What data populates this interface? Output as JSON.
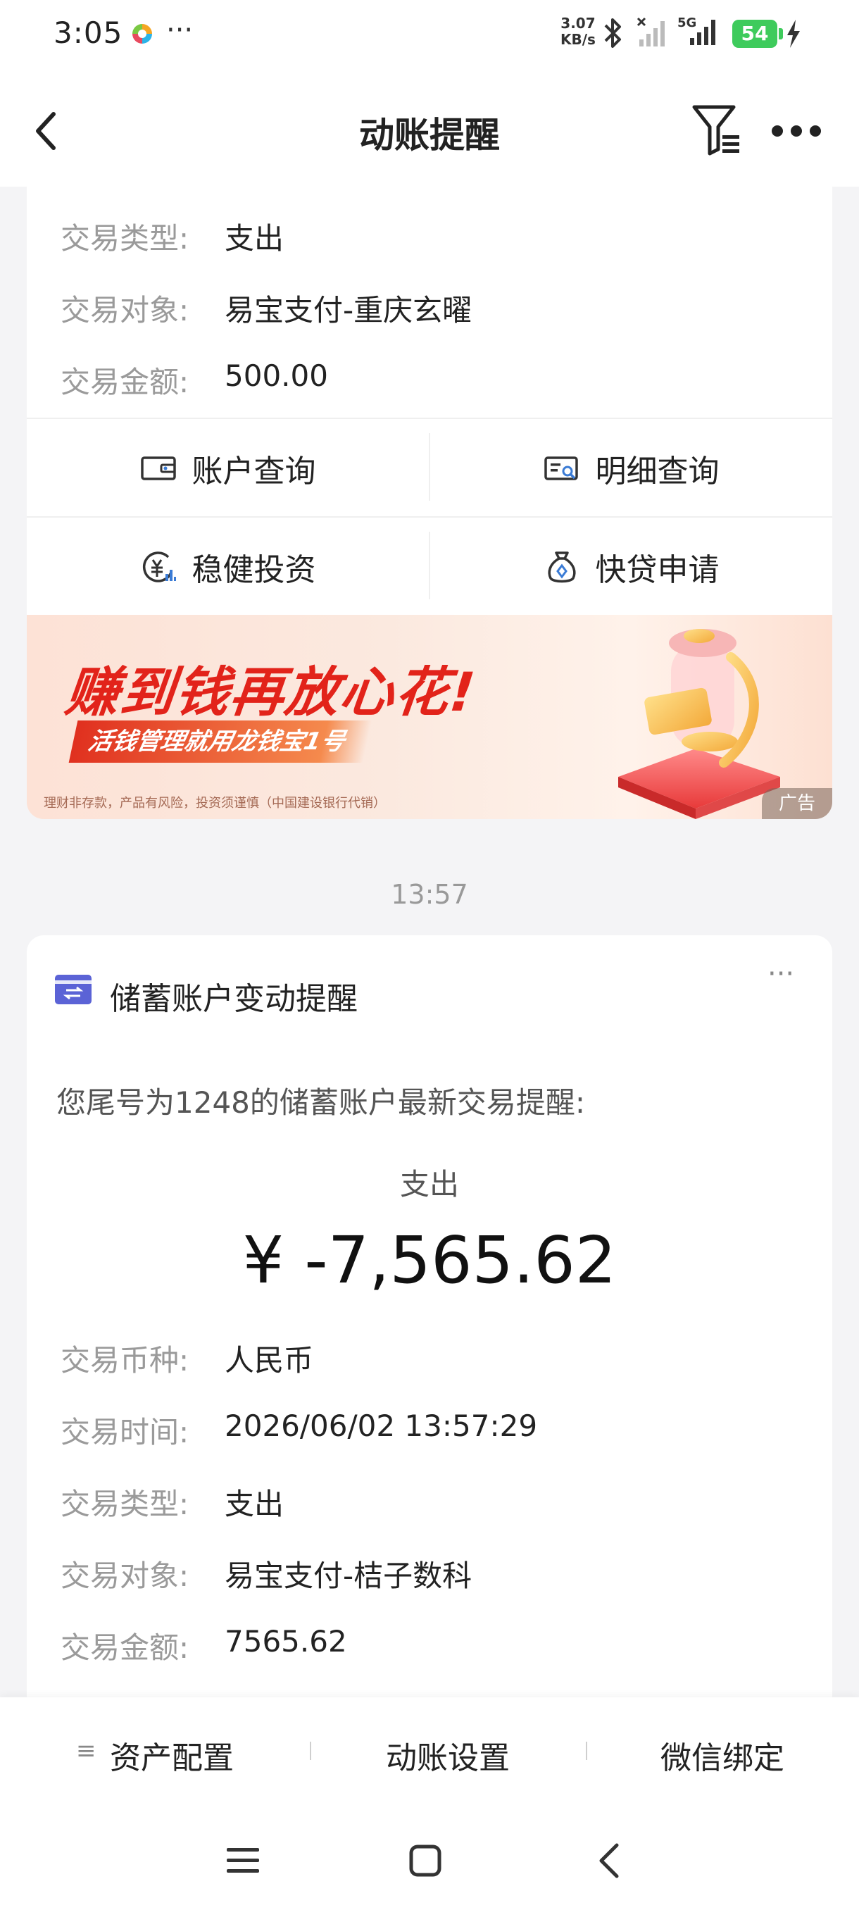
{
  "status_bar": {
    "time": "3:05",
    "dots": "···",
    "net_speed_value": "3.07",
    "net_speed_unit": "KB/s",
    "network": "5G",
    "battery": "54"
  },
  "header": {
    "title": "动账提醒"
  },
  "prev_card": {
    "rows": [
      {
        "label": "交易类型:",
        "value": "支出"
      },
      {
        "label": "交易对象:",
        "value": "易宝支付-重庆玄曜"
      },
      {
        "label": "交易金额:",
        "value": "500.00"
      }
    ],
    "quick_actions": [
      {
        "label": "账户查询",
        "icon": "wallet-icon"
      },
      {
        "label": "明细查询",
        "icon": "detail-search-icon"
      },
      {
        "label": "稳健投资",
        "icon": "yuan-chart-icon"
      },
      {
        "label": "快贷申请",
        "icon": "loan-bag-icon"
      }
    ]
  },
  "banner": {
    "title": "赚到钱再放心花!",
    "subtitle": "活钱管理就用龙钱宝1号",
    "disclaimer": "理财非存款，产品有风险，投资须谨慎（中国建设银行代销）",
    "ad_label": "广告"
  },
  "time_separator": "13:57",
  "alert_card": {
    "title": "储蓄账户变动提醒",
    "more": "···",
    "message": "您尾号为1248的储蓄账户最新交易提醒:",
    "tx_type_heading": "支出",
    "amount": "¥ -7,565.62",
    "rows": [
      {
        "label": "交易币种:",
        "value": "人民币"
      },
      {
        "label": "交易时间:",
        "value": "2026/06/02 13:57:29"
      },
      {
        "label": "交易类型:",
        "value": "支出"
      },
      {
        "label": "交易对象:",
        "value": "易宝支付-桔子数科"
      },
      {
        "label": "交易金额:",
        "value": "7565.62"
      }
    ]
  },
  "bottom_bar": {
    "items": [
      {
        "label": "资产配置"
      },
      {
        "label": "动账设置"
      },
      {
        "label": "微信绑定"
      }
    ],
    "menu_glyph": "≡"
  },
  "colors": {
    "accent_red": "#e2231a",
    "battery_green": "#3ecb5c",
    "card_icon_blue": "#5b63d6"
  }
}
